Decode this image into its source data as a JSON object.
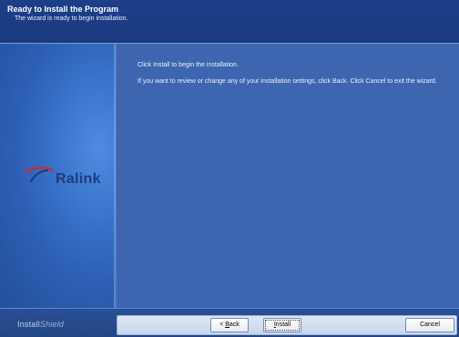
{
  "header": {
    "title": "Ready to Install the Program",
    "subtitle": "The wizard is ready to begin installation."
  },
  "content": {
    "line1": "Click Install to begin the installation.",
    "line2": "If you want to review or change any of your installation settings, click Back. Click Cancel to exit the wizard."
  },
  "logo": {
    "text": "Ralink",
    "mark_icon": "ralink-swoosh-icon",
    "color": "#1e3c7f"
  },
  "footer": {
    "brand_part1": "Install",
    "brand_part2": "Shield",
    "buttons": {
      "back_prefix": "< ",
      "back_underline": "B",
      "back_rest": "ack",
      "install_underline": "I",
      "install_rest": "nstall",
      "cancel": "Cancel"
    }
  },
  "colors": {
    "header_bg": "#1d3f88",
    "content_bg": "#3e66b0",
    "logo_red": "#d6262c"
  }
}
